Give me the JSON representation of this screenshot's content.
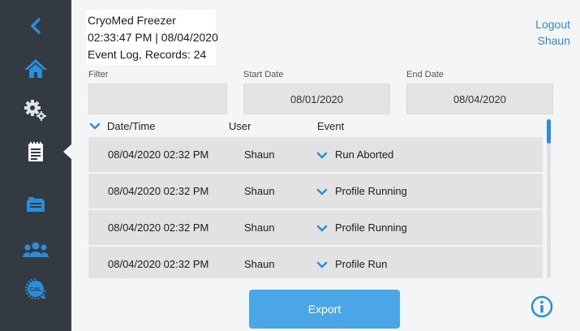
{
  "app": {
    "name": "CryoMed Freezer",
    "datetime": "02:33:47 PM | 08/04/2020",
    "page_info": "Event Log, Records: 24"
  },
  "account": {
    "logout_label": "Logout",
    "user_name": "Shaun"
  },
  "sidebar": {
    "items": [
      {
        "icon": "back-chevron-icon"
      },
      {
        "icon": "home-icon"
      },
      {
        "icon": "settings-gears-icon"
      },
      {
        "icon": "event-log-clipboard-icon",
        "active": true
      },
      {
        "icon": "profiles-folder-icon"
      },
      {
        "icon": "users-group-icon"
      },
      {
        "icon": "calibration-icon",
        "text": "CAL"
      }
    ]
  },
  "filters": {
    "filter_label": "Filter",
    "filter_value": "",
    "start_label": "Start Date",
    "start_value": "08/01/2020",
    "end_label": "End Date",
    "end_value": "08/04/2020"
  },
  "table": {
    "columns": [
      "Date/Time",
      "User",
      "Event"
    ],
    "rows": [
      {
        "datetime": "08/04/2020 02:32 PM",
        "user": "Shaun",
        "event": "Run Aborted"
      },
      {
        "datetime": "08/04/2020 02:32 PM",
        "user": "Shaun",
        "event": "Profile Running"
      },
      {
        "datetime": "08/04/2020 02:32 PM",
        "user": "Shaun",
        "event": "Profile Running"
      },
      {
        "datetime": "08/04/2020 02:32 PM",
        "user": "Shaun",
        "event": "Profile Run"
      }
    ]
  },
  "actions": {
    "export_label": "Export"
  },
  "colors": {
    "sidebar": "#343a41",
    "accent": "#2a8fd8",
    "button": "#4aa6e6",
    "row": "#e2e2e2"
  }
}
